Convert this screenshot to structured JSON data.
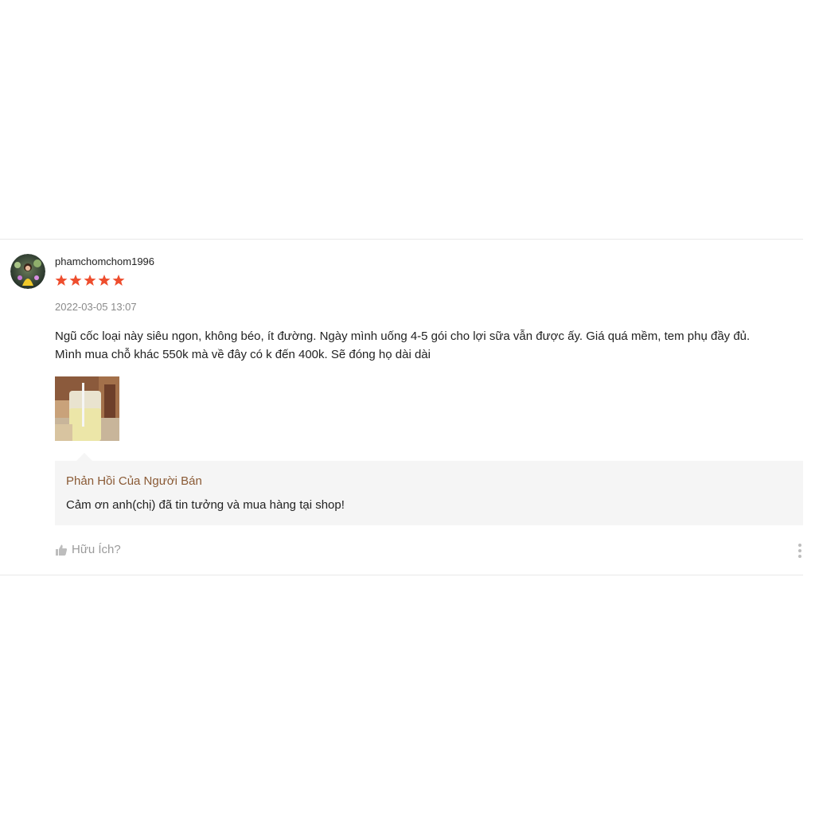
{
  "review": {
    "username": "phamchomchom1996",
    "rating": 5,
    "timestamp": "2022-03-05 13:07",
    "text_line1": "Ngũ cốc loại này siêu ngon, không béo, ít đường. Ngày mình uống 4-5 gói cho lợi sữa vẫn được ấy. Giá quá mềm, tem phụ đầy đủ.",
    "text_line2": "Mình mua chỗ khác 550k mà về đây có k đến 400k. Sẽ đóng họ dài dài"
  },
  "seller_reply": {
    "title": "Phản Hồi Của Người Bán",
    "text": "Cảm ơn anh(chị) đã tin tưởng và mua hàng tại shop!"
  },
  "actions": {
    "helpful_label": "Hữu Ích?"
  },
  "colors": {
    "star": "#ee4d2d",
    "reply_title": "#8a5a35",
    "reply_bg": "#f5f5f5",
    "muted": "#9b9b9b"
  },
  "icons": {
    "like": "thumbs-up-icon",
    "more": "more-vertical-icon"
  }
}
